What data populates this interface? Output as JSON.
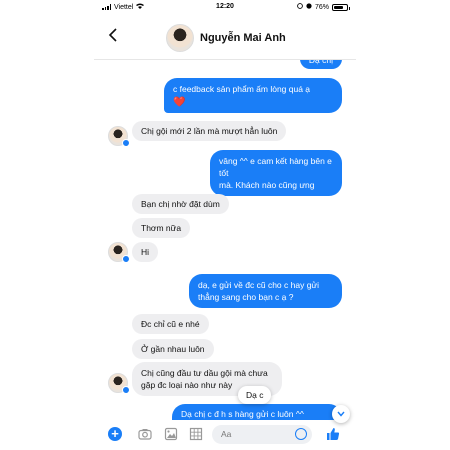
{
  "status_bar": {
    "carrier": "Viettel",
    "time": "12:20",
    "battery": "76%"
  },
  "header": {
    "contact_name": "Nguyễn Mai Anh"
  },
  "messages": [
    {
      "side": "out",
      "text": "Dạ chị"
    },
    {
      "side": "out",
      "text": "c feedback sản phẩm ấm lòng quá ạ"
    },
    {
      "side": "out",
      "text": "❤️"
    },
    {
      "side": "in",
      "text": "Chị gội mới 2 lần mà mượt hẳn luôn"
    },
    {
      "side": "out",
      "text": "vâng ^^ e cam kết hàng bên e tốt"
    },
    {
      "side": "out",
      "text": "mà. Khách nào cũng ưng"
    },
    {
      "side": "in",
      "text": "Bạn chị nhờ đặt dùm"
    },
    {
      "side": "in",
      "text": "Thơm nữa"
    },
    {
      "side": "in",
      "text": "Hi"
    },
    {
      "side": "out",
      "text": "dạ, e gửi về đc cũ cho c hay gửi"
    },
    {
      "side": "out",
      "text": "thẳng sang cho bạn c ạ ?"
    },
    {
      "side": "in",
      "text": "Đc chỉ cũ e nhé"
    },
    {
      "side": "in",
      "text": "Ở gần nhau luôn"
    },
    {
      "side": "in",
      "text": "Chị cũng đầu tư dầu gội mà chưa"
    },
    {
      "side": "in",
      "text": "gặp đc loại nào như này"
    },
    {
      "side": "out",
      "text": "Dạ chị c đ h s hàng gửi c luôn ^^"
    }
  ],
  "float_label": "Dạ c",
  "composer": {
    "placeholder": "Aa"
  },
  "colors": {
    "accent": "#1a7ef7",
    "incoming_bubble": "#eeeef0"
  }
}
